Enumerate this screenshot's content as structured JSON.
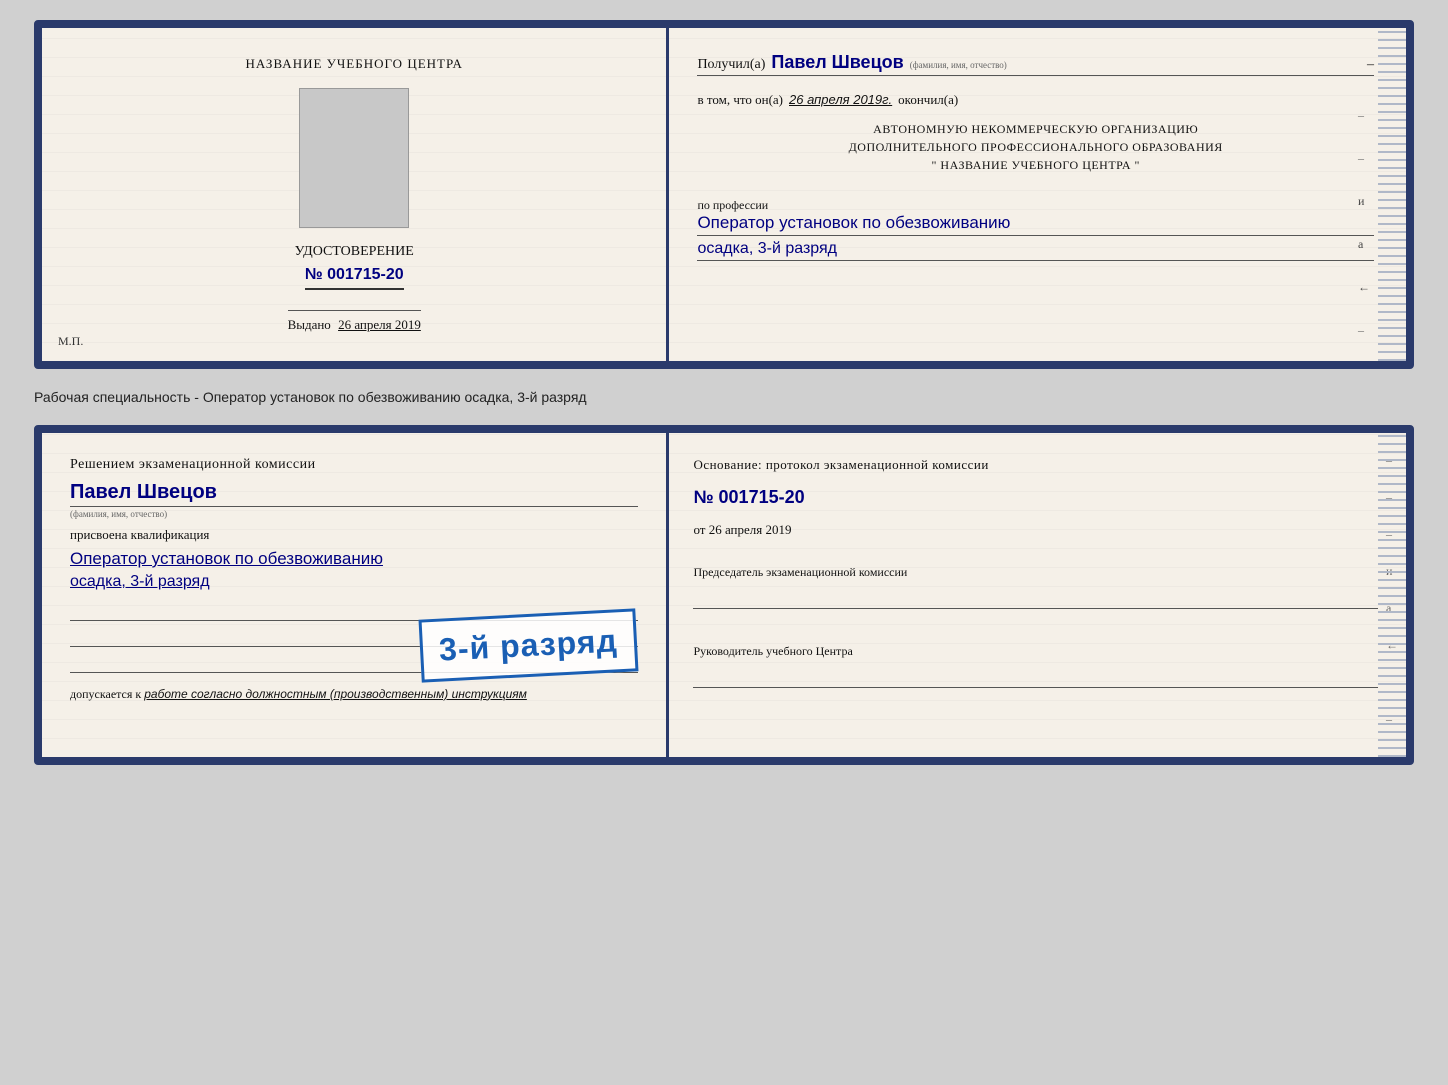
{
  "page": {
    "background": "#d0d0d0"
  },
  "doc1": {
    "left": {
      "title": "НАЗВАНИЕ УЧЕБНОГО ЦЕНТРА",
      "photo_alt": "фото",
      "udost_label": "УДОСТОВЕРЕНИЕ",
      "number_prefix": "№",
      "number": "001715-20",
      "vydano_label": "Выдано",
      "vydano_date": "26 апреля 2019",
      "mp": "М.П."
    },
    "right": {
      "poluchil_label": "Получил(а)",
      "recipient_name": "Павел Швецов",
      "fio_sub": "(фамилия, имя, отчество)",
      "dash": "–",
      "v_tom_label": "в том, что он(а)",
      "date_handwritten": "26 апреля 2019г.",
      "okончил_label": "окончил(а)",
      "org_line1": "АВТОНОМНУЮ НЕКОММЕРЧЕСКУЮ ОРГАНИЗАЦИЮ",
      "org_line2": "ДОПОЛНИТЕЛЬНОГО ПРОФЕССИОНАЛЬНОГО ОБРАЗОВАНИЯ",
      "org_line3": "\"  НАЗВАНИЕ УЧЕБНОГО ЦЕНТРА  \"",
      "i_label": "и",
      "a_label": "а",
      "arrow_label": "←",
      "po_professii_label": "по профессии",
      "profession": "Оператор установок по обезвоживанию",
      "specialty": "осадка, 3-й разряд"
    }
  },
  "between": {
    "label": "Рабочая специальность - Оператор установок по обезвоживанию осадка, 3-й разряд"
  },
  "doc2": {
    "left": {
      "resheniem_label": "Решением экзаменационной комиссии",
      "person_name": "Павел Швецов",
      "fio_sub": "(фамилия, имя, отчество)",
      "prisvoena_label": "присвоена квалификация",
      "qualification1": "Оператор установок по обезвоживанию",
      "qualification2": "осадка, 3-й разряд",
      "dopuskaetsya_label": "допускается к",
      "dopuskaetsya_val": "работе согласно должностным (производственным) инструкциям"
    },
    "stamp": {
      "line1": "3-й разряд"
    },
    "right": {
      "osnovanie_label": "Основание: протокол экзаменационной комиссии",
      "number_prefix": "№",
      "number": "001715-20",
      "ot_prefix": "от",
      "ot_date": "26 апреля 2019",
      "predsedatel_label": "Председатель экзаменационной комиссии",
      "rukovoditel_label": "Руководитель учебного Центра",
      "dash_items": [
        "–",
        "–",
        "–",
        "и",
        "а",
        "←",
        "–",
        "–",
        "–"
      ]
    }
  }
}
